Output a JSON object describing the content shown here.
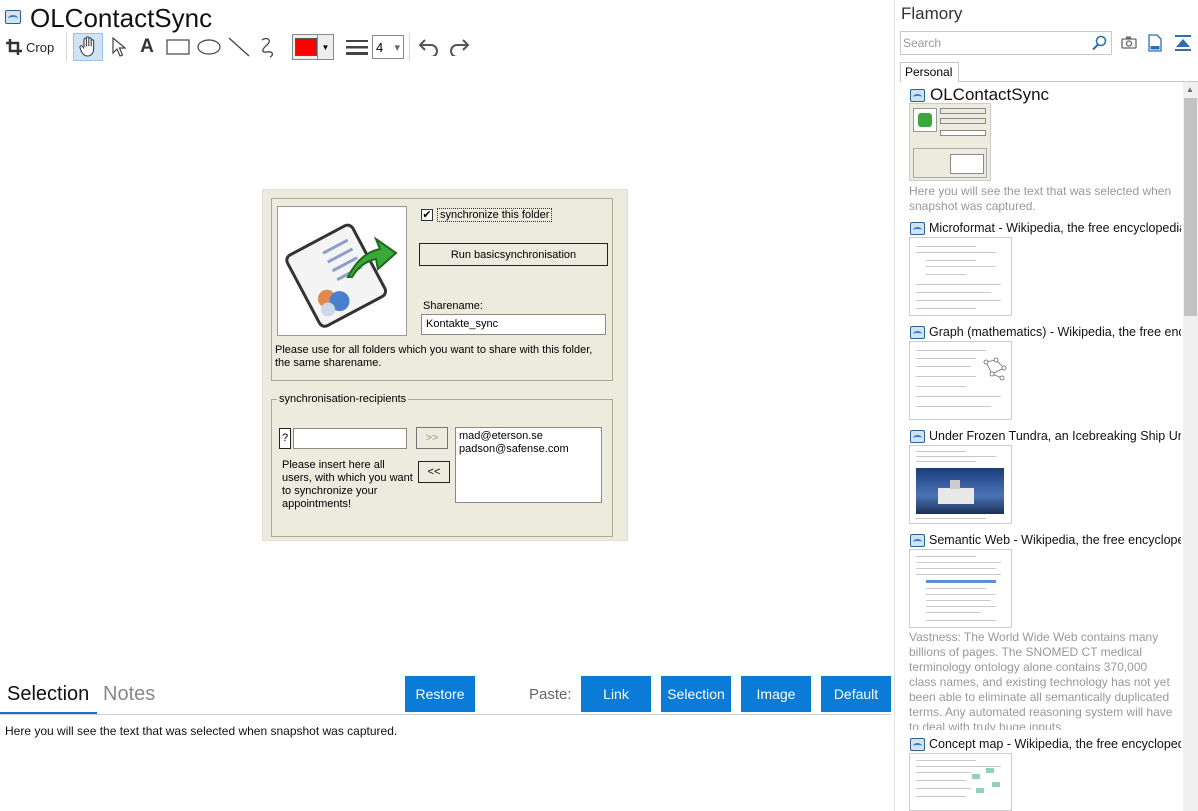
{
  "app": {
    "title": "OLContactSync"
  },
  "toolbar": {
    "crop_label": "Crop",
    "text_tool": "A",
    "color": "#ff0000",
    "color_arrow": "▼",
    "line_width": "4",
    "line_width_arrow": "▾"
  },
  "snapshot": {
    "sync_check_mark": "✔",
    "sync_label": "synchronize this folder",
    "run_button": "Run basicsynchronisation",
    "share_label": "Sharename:",
    "share_value": "Kontakte_sync",
    "share_hint": "Please use for all folders which you want to share with this folder, the same sharename.",
    "recipients_title": "synchronisation-recipients",
    "q_button": "?",
    "add_button": ">>",
    "remove_button": "<<",
    "recipients_hint": "Please insert here all users, with which you want to synchronize your appointments!",
    "recipients": [
      "mad@eterson.se",
      "padson@safense.com"
    ]
  },
  "bottom_panel": {
    "tabs": [
      "Selection",
      "Notes"
    ],
    "active_tab": "Selection",
    "restore": "Restore",
    "paste_label": "Paste:",
    "paste_buttons": [
      "Link",
      "Selection",
      "Image",
      "Default"
    ],
    "selection_text": "Here you will see the text that was selected when snapshot was captured."
  },
  "sidebar": {
    "title": "Flamory",
    "search_placeholder": "Search",
    "tab": "Personal",
    "items": [
      {
        "title": "OLContactSync",
        "desc": "Here you will see the text that was selected when snapshot was captured."
      },
      {
        "title": "Microformat - Wikipedia, the free encyclopedia",
        "desc": ""
      },
      {
        "title": "Graph (mathematics) - Wikipedia, the free encyclopedia",
        "desc": ""
      },
      {
        "title": "Under Frozen Tundra, an Icebreaking Ship Uncovers",
        "desc": ""
      },
      {
        "title": "Semantic Web - Wikipedia, the free encyclopedia",
        "desc": "Vastness: The World Wide Web contains many billions of pages. The SNOMED CT medical terminology ontology alone contains 370,000 class names, and existing technology has not yet been able to eliminate all semantically duplicated terms. Any automated reasoning system will have to deal with truly huge inputs."
      },
      {
        "title": "Concept map - Wikipedia, the free encyclopedia",
        "desc": ""
      }
    ]
  },
  "colors": {
    "accent": "#0a7bd6",
    "dialog_bg": "#ecebdd"
  }
}
